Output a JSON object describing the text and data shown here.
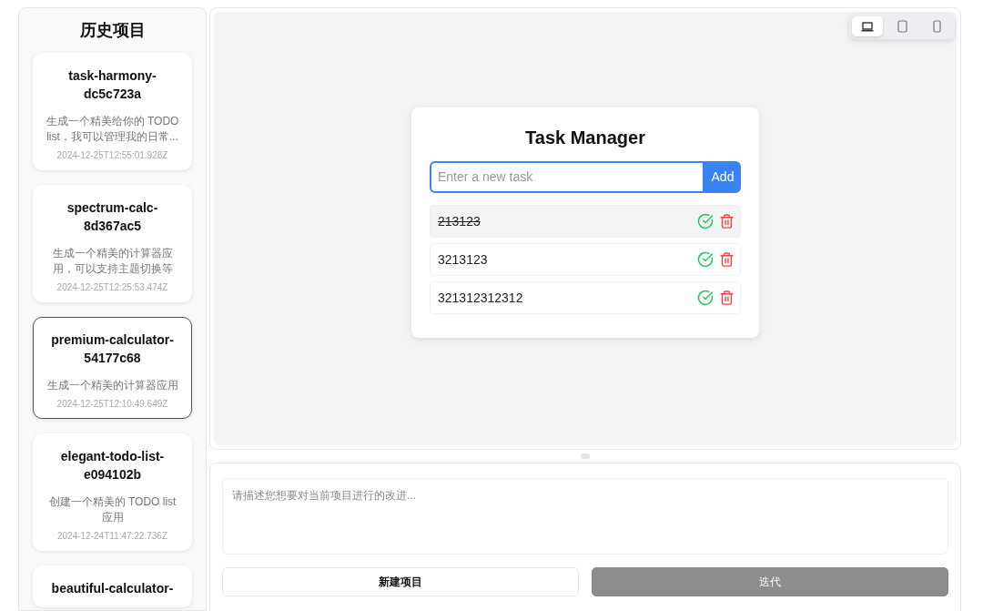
{
  "sidebar": {
    "title": "历史项目",
    "projects": [
      {
        "name": "task-harmony-dc5c723a",
        "description": "生成一个精美给你的 TODO list，我可以管理我的日常...",
        "timestamp": "2024-12-25T12:55:01.928Z",
        "selected": false
      },
      {
        "name": "spectrum-calc-8d367ac5",
        "description": "生成一个精美的计算器应用，可以支持主题切换等",
        "timestamp": "2024-12-25T12:25:53.474Z",
        "selected": false
      },
      {
        "name": "premium-calculator-54177c68",
        "description": "生成一个精美的计算器应用",
        "timestamp": "2024-12-25T12:10:49.649Z",
        "selected": true
      },
      {
        "name": "elegant-todo-list-e094102b",
        "description": "创建一个精美的 TODO list 应用",
        "timestamp": "2024-12-24T11:47:22.736Z",
        "selected": false
      },
      {
        "name": "beautiful-calculator-",
        "selected": false
      }
    ]
  },
  "devices": [
    {
      "kind": "laptop",
      "selected": true
    },
    {
      "kind": "tablet",
      "selected": false
    },
    {
      "kind": "phone",
      "selected": false
    }
  ],
  "preview": {
    "title": "Task Manager",
    "input": {
      "placeholder": "Enter a new task"
    },
    "add_button": "Add",
    "tasks": [
      {
        "text": "213123",
        "completed": true
      },
      {
        "text": "3213123",
        "completed": false
      },
      {
        "text": "321312312312",
        "completed": false
      }
    ]
  },
  "prompt": {
    "placeholder": "请描述您想要对当前项目进行的改进..."
  },
  "buttons": [
    {
      "label": "新建项目",
      "kind": "secondary"
    },
    {
      "label": "迭代",
      "kind": "primary"
    }
  ]
}
